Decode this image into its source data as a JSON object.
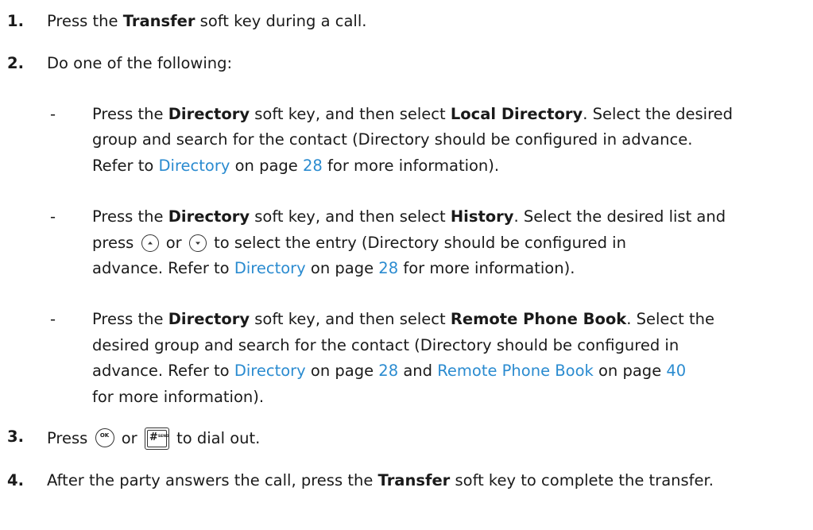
{
  "steps": [
    {
      "number": "1.",
      "pre": "Press the ",
      "bold": "Transfer",
      "post": " soft key during a call."
    },
    {
      "number": "2.",
      "text": "Do one of the following:"
    },
    {
      "number": "3.",
      "press": "Press",
      "or": "or",
      "post": "to dial out."
    },
    {
      "number": "4.",
      "pre": "After the party answers the call, press the ",
      "bold": "Transfer",
      "post": " soft key to complete the transfer."
    }
  ],
  "options": [
    {
      "dash": "-",
      "l1": {
        "t1": "Press the ",
        "b1": "Directory",
        "t2": " soft key, and then select ",
        "b2": "Local Directory",
        "t3": ". Select the desired"
      },
      "l2": "group and search for the contact (Directory should be configured in advance.",
      "l3": {
        "t1": "Refer to ",
        "link1": "Directory",
        "t2": " on page ",
        "page1": "28",
        "t3": " for more information)."
      }
    },
    {
      "dash": "-",
      "l1": {
        "t1": "Press the ",
        "b1": "Directory",
        "t2": " soft key, and then select ",
        "b2": "History",
        "t3": ". Select the desired list and"
      },
      "l2": {
        "t1": "press",
        "t2": "or",
        "t3": "to select the entry (Directory should be configured in"
      },
      "l3": {
        "t1": "advance. Refer to ",
        "link1": "Directory",
        "t2": " on page ",
        "page1": "28",
        "t3": " for more information)."
      }
    },
    {
      "dash": "-",
      "l1": {
        "t1": "Press the ",
        "b1": "Directory",
        "t2": " soft key, and then select ",
        "b2": "Remote Phone Book",
        "t3": ". Select the"
      },
      "l2": "desired group and search for the contact (Directory should be configured in",
      "l3": {
        "t1": "advance. Refer to ",
        "link1": "Directory",
        "t2": " on page ",
        "page1": "28",
        "t3": " and ",
        "link2": "Remote Phone Book",
        "t4": " on page ",
        "page2": "40"
      },
      "l4": "for more information)."
    }
  ],
  "keys": {
    "ok_label": "OK",
    "hash_label": "#",
    "send_label": "SEND"
  },
  "colors": {
    "link": "#2a8bd0",
    "text": "#1a1a1a"
  }
}
